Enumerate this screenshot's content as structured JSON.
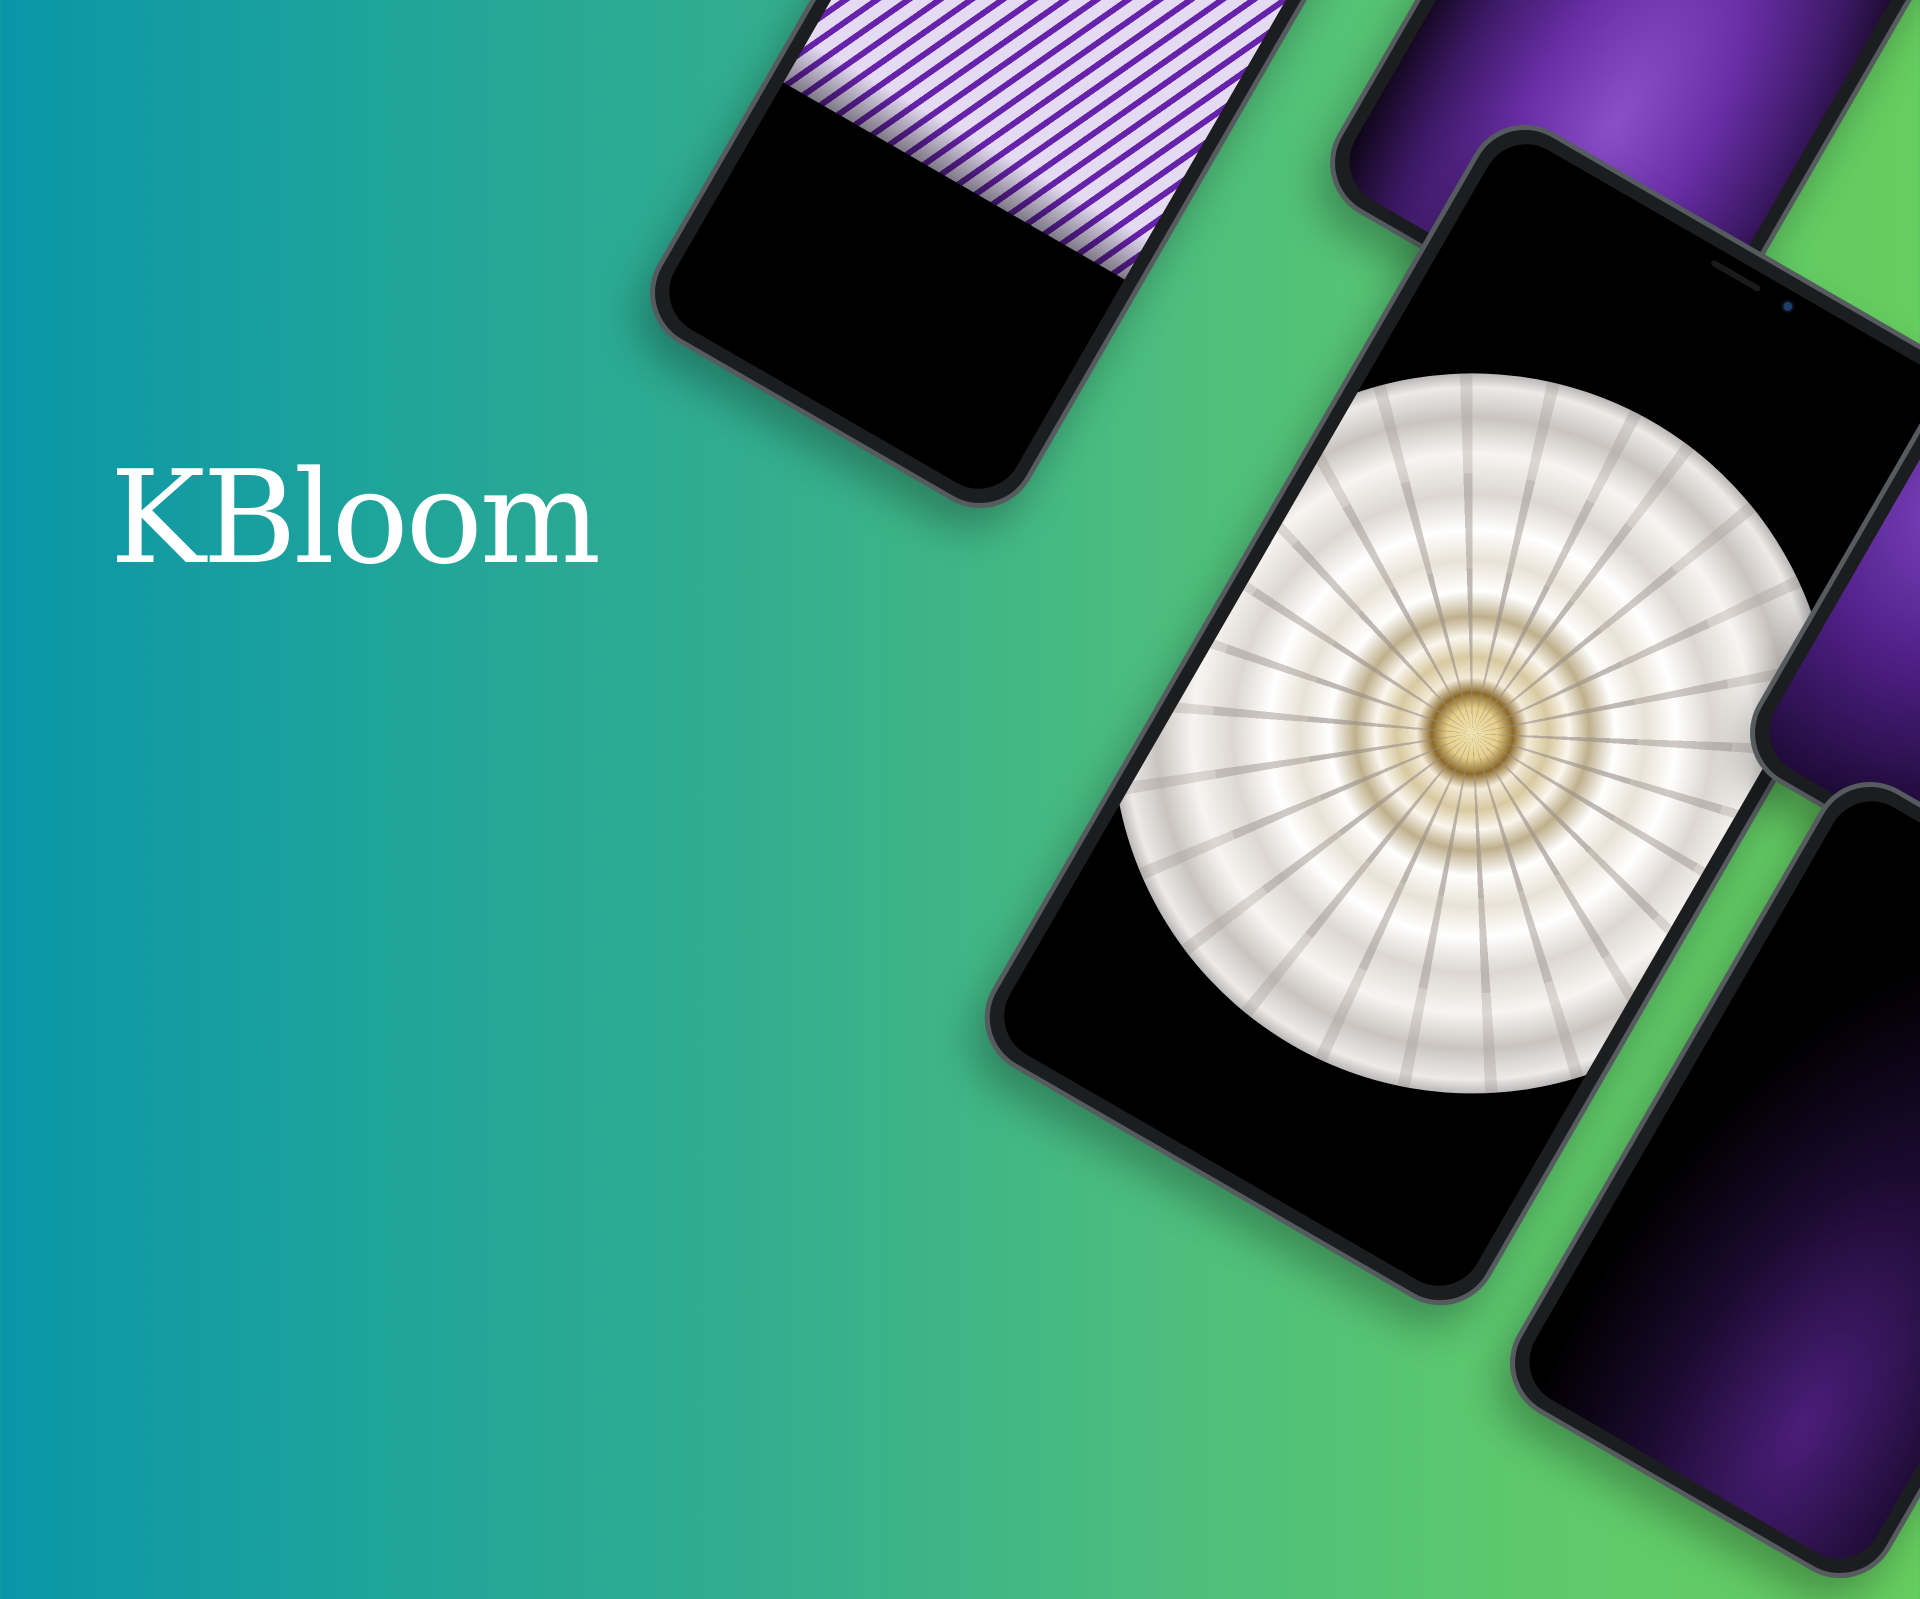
{
  "brand": {
    "name": "KBloom"
  },
  "colors": {
    "gradient_start": "#0a96a8",
    "gradient_end": "#66cd5f",
    "text": "#ffffff"
  },
  "phones": [
    {
      "id": "phone-1",
      "screen_image": "purple-striped-petals"
    },
    {
      "id": "phone-2",
      "screen_image": "purple-petals"
    },
    {
      "id": "phone-3",
      "screen_image": "white-dahlia-flower"
    },
    {
      "id": "phone-4",
      "screen_image": "purple-petal-edge"
    },
    {
      "id": "phone-5",
      "screen_image": "dark-purple-flower"
    }
  ]
}
